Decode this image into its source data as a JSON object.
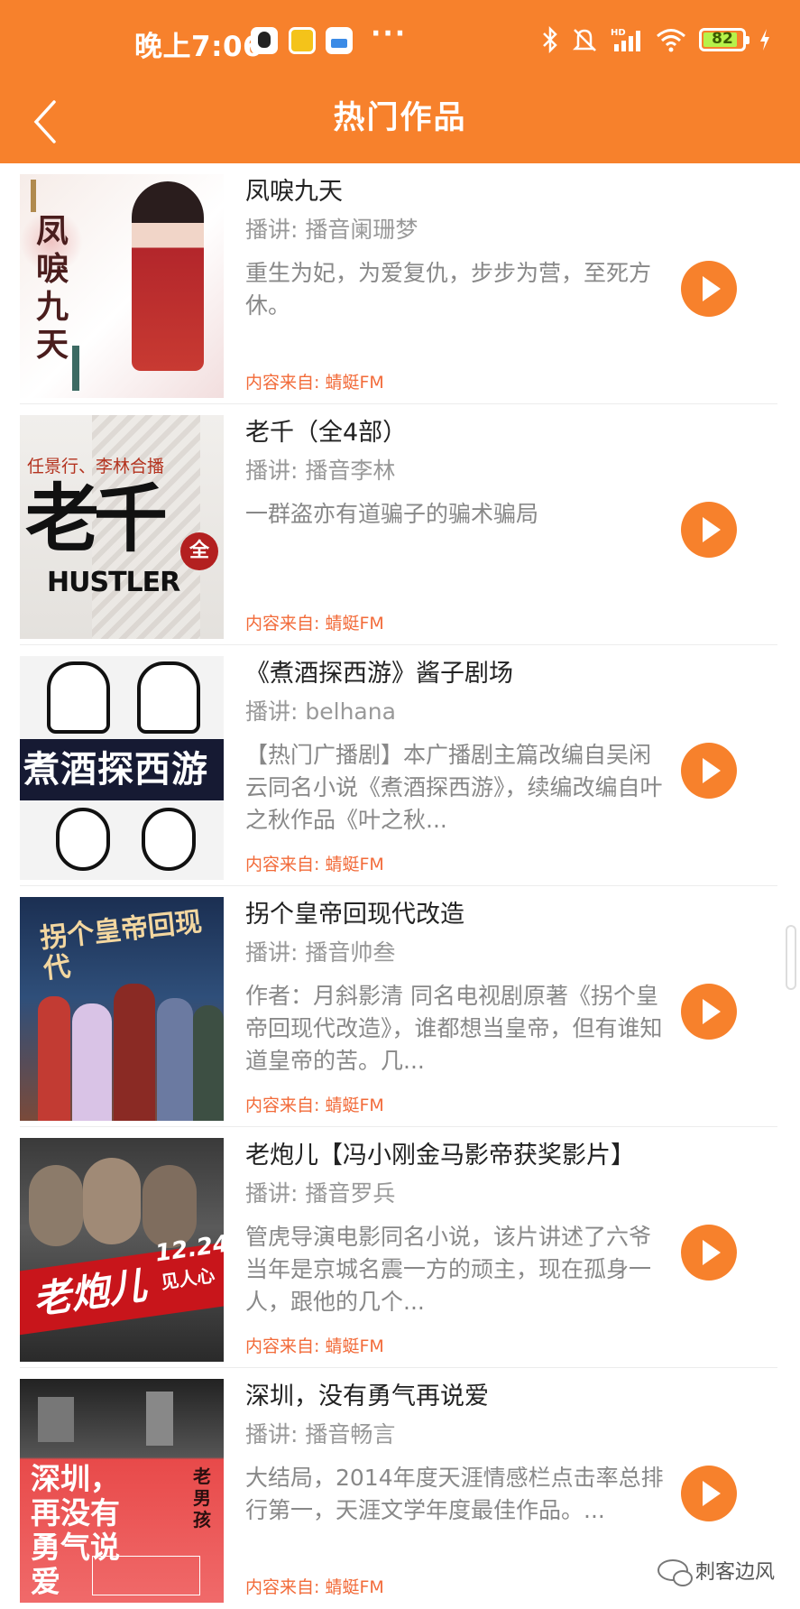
{
  "status_bar": {
    "time": "晚上7:06",
    "overflow": "···",
    "battery": "82",
    "icons": [
      "qq-icon",
      "notes-icon",
      "pen-icon",
      "bluetooth-icon",
      "mute-icon",
      "hd-signal-icon",
      "wifi-icon",
      "battery-icon",
      "charging-icon"
    ]
  },
  "nav": {
    "title": "热门作品",
    "back_icon": "back-chevron-icon"
  },
  "items": [
    {
      "title": "凤唳九天",
      "host": "播讲: 播音阑珊梦",
      "desc": "重生为妃，为爱复仇，步步为营，至死方休。",
      "source": "内容来自: 蜻蜓FM",
      "cover_text": "凤唳九天"
    },
    {
      "title": "老千（全4部）",
      "host": "播讲: 播音李林",
      "desc": "一群盗亦有道骗子的骗术骗局",
      "source": "内容来自: 蜻蜓FM",
      "cover_text": "老千",
      "cover_caption": "任景行、李林合播",
      "cover_sub": "HUSTLER",
      "cover_badge": "全"
    },
    {
      "title": "《煮酒探西游》酱子剧场",
      "host": "播讲: belhana",
      "desc": "【热门广播剧】本广播剧主篇改编自吴闲云同名小说《煮酒探西游》，续编改编自叶之秋作品《叶之秋...",
      "source": "内容来自: 蜻蜓FM",
      "cover_text": "煮酒探西游"
    },
    {
      "title": "拐个皇帝回现代改造",
      "host": "播讲: 播音帅叁",
      "desc": "作者：月斜影清 同名电视剧原著《拐个皇帝回现代改造》，谁都想当皇帝，但有谁知道皇帝的苦。几...",
      "source": "内容来自: 蜻蜓FM",
      "cover_text": "拐个皇帝回现代"
    },
    {
      "title": "老炮儿【冯小刚金马影帝获奖影片】",
      "host": "播讲: 播音罗兵",
      "desc": "管虎导演电影同名小说，该片讲述了六爷当年是京城名震一方的顽主，现在孤身一人，跟他的几个...",
      "source": "内容来自: 蜻蜓FM",
      "cover_text": "老炮儿",
      "cover_date": "12.24",
      "cover_tag": "见人心"
    },
    {
      "title": "深圳，没有勇气再说爱",
      "host": "播讲: 播音畅言",
      "desc": "大结局，2014年度天涯情感栏点击率总排行第一，天涯文学年度最佳作品。...",
      "source": "内容来自: 蜻蜓FM",
      "cover_text": "深圳，再没有勇气说爱",
      "cover_tag": "老男孩"
    }
  ],
  "watermark": "刺客边风",
  "colors": {
    "accent": "#f7812c",
    "source_text": "#f26b3a"
  }
}
